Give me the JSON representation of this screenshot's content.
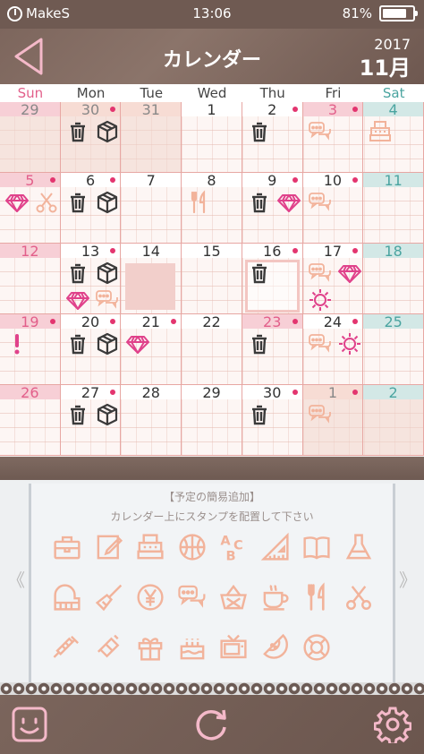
{
  "status_bar": {
    "carrier": "MakeS",
    "time": "13:06",
    "battery": "81%",
    "battery_level": 0.81
  },
  "header": {
    "title": "カレンダー",
    "year": "2017",
    "month": "11月"
  },
  "weekdays": [
    "Sun",
    "Mon",
    "Tue",
    "Wed",
    "Thu",
    "Fri",
    "Sat"
  ],
  "weeks": [
    {
      "days": [
        {
          "n": "29",
          "bar": "pink",
          "num": "gray",
          "out": true,
          "dot": false,
          "stamps": []
        },
        {
          "n": "30",
          "bar": "peach",
          "num": "gray",
          "out": true,
          "dot": true,
          "stamps": [
            "trash-icon",
            "box-icon"
          ]
        },
        {
          "n": "31",
          "bar": "peach",
          "num": "gray",
          "out": true,
          "dot": false,
          "stamps": []
        },
        {
          "n": "1",
          "bar": "white",
          "num": "",
          "out": false,
          "dot": false,
          "stamps": []
        },
        {
          "n": "2",
          "bar": "white",
          "num": "",
          "out": false,
          "dot": true,
          "stamps": [
            "trash-icon"
          ]
        },
        {
          "n": "3",
          "bar": "pink",
          "num": "red",
          "out": false,
          "dot": true,
          "stamps": [
            "chat-icon"
          ]
        },
        {
          "n": "4",
          "bar": "teal",
          "num": "teal",
          "out": false,
          "dot": false,
          "stamps": [
            "register-icon"
          ]
        }
      ]
    },
    {
      "days": [
        {
          "n": "5",
          "bar": "pink",
          "num": "red",
          "out": false,
          "dot": true,
          "stamps": [
            "gem-icon",
            "scissors-icon"
          ]
        },
        {
          "n": "6",
          "bar": "white",
          "num": "",
          "out": false,
          "dot": true,
          "stamps": [
            "trash-icon",
            "box-icon"
          ]
        },
        {
          "n": "7",
          "bar": "white",
          "num": "",
          "out": false,
          "dot": false,
          "stamps": []
        },
        {
          "n": "8",
          "bar": "white",
          "num": "",
          "out": false,
          "dot": false,
          "stamps": [
            "fork-knife-icon"
          ]
        },
        {
          "n": "9",
          "bar": "white",
          "num": "",
          "out": false,
          "dot": true,
          "stamps": [
            "trash-icon",
            "gem-icon"
          ]
        },
        {
          "n": "10",
          "bar": "white",
          "num": "",
          "out": false,
          "dot": true,
          "stamps": [
            "chat-icon"
          ]
        },
        {
          "n": "11",
          "bar": "teal",
          "num": "teal",
          "out": false,
          "dot": false,
          "stamps": []
        }
      ]
    },
    {
      "days": [
        {
          "n": "12",
          "bar": "pink",
          "num": "red",
          "out": false,
          "dot": false,
          "stamps": []
        },
        {
          "n": "13",
          "bar": "white",
          "num": "",
          "out": false,
          "dot": true,
          "stamps": [
            "trash-icon",
            "box-icon",
            "gem-icon",
            "chat-icon"
          ]
        },
        {
          "n": "14",
          "bar": "white",
          "num": "",
          "out": false,
          "dot": false,
          "stamps": [],
          "fill": true
        },
        {
          "n": "15",
          "bar": "white",
          "num": "",
          "out": false,
          "dot": false,
          "stamps": []
        },
        {
          "n": "16",
          "bar": "white",
          "num": "",
          "out": false,
          "dot": true,
          "stamps": [
            "trash-icon"
          ],
          "selected": true
        },
        {
          "n": "17",
          "bar": "white",
          "num": "",
          "out": false,
          "dot": true,
          "stamps": [
            "chat-icon",
            "gem-icon",
            "sun-icon"
          ]
        },
        {
          "n": "18",
          "bar": "teal",
          "num": "teal",
          "out": false,
          "dot": false,
          "stamps": []
        }
      ]
    },
    {
      "days": [
        {
          "n": "19",
          "bar": "pink",
          "num": "red",
          "out": false,
          "dot": true,
          "stamps": [
            "exclaim-icon"
          ]
        },
        {
          "n": "20",
          "bar": "white",
          "num": "",
          "out": false,
          "dot": true,
          "stamps": [
            "trash-icon",
            "box-icon"
          ]
        },
        {
          "n": "21",
          "bar": "white",
          "num": "",
          "out": false,
          "dot": true,
          "stamps": [
            "gem-icon"
          ]
        },
        {
          "n": "22",
          "bar": "white",
          "num": "",
          "out": false,
          "dot": false,
          "stamps": []
        },
        {
          "n": "23",
          "bar": "pink",
          "num": "red",
          "out": false,
          "dot": true,
          "stamps": [
            "trash-icon"
          ]
        },
        {
          "n": "24",
          "bar": "white",
          "num": "",
          "out": false,
          "dot": true,
          "stamps": [
            "chat-icon",
            "sun-icon"
          ]
        },
        {
          "n": "25",
          "bar": "teal",
          "num": "teal",
          "out": false,
          "dot": false,
          "stamps": []
        }
      ]
    },
    {
      "days": [
        {
          "n": "26",
          "bar": "pink",
          "num": "red",
          "out": false,
          "dot": false,
          "stamps": []
        },
        {
          "n": "27",
          "bar": "white",
          "num": "",
          "out": false,
          "dot": true,
          "stamps": [
            "trash-icon",
            "box-icon"
          ]
        },
        {
          "n": "28",
          "bar": "white",
          "num": "",
          "out": false,
          "dot": false,
          "stamps": []
        },
        {
          "n": "29",
          "bar": "white",
          "num": "",
          "out": false,
          "dot": false,
          "stamps": []
        },
        {
          "n": "30",
          "bar": "white",
          "num": "",
          "out": false,
          "dot": true,
          "stamps": [
            "trash-icon"
          ]
        },
        {
          "n": "1",
          "bar": "peach",
          "num": "gray",
          "out": true,
          "dot": true,
          "stamps": [
            "chat-icon"
          ]
        },
        {
          "n": "2",
          "bar": "teal",
          "num": "teal",
          "out": true,
          "dot": false,
          "stamps": []
        }
      ]
    }
  ],
  "panel": {
    "title": "【予定の簡易追加】",
    "subtitle": "カレンダー上にスタンプを配置して下さい",
    "stamps": [
      [
        "briefcase-icon",
        "pencil-note-icon",
        "register-icon",
        "basketball-icon",
        "abc-icon",
        "ruler-icon",
        "book-icon",
        "flask-icon"
      ],
      [
        "piano-icon",
        "broom-icon",
        "yen-icon",
        "chat-icon",
        "basket-icon",
        "cup-icon",
        "fork-knife-icon",
        "scissors-icon"
      ],
      [
        "syringe-icon",
        "ticket-icon",
        "gift-icon",
        "cake-icon",
        "tv-icon",
        "watermelon-icon",
        "lifebuoy-icon"
      ]
    ],
    "left_arrow": "《",
    "right_arrow": "》"
  },
  "colors": {
    "accent": "#e3356f",
    "stamp_dark": "#3a3a3a",
    "stamp_pink": "#e0428b",
    "stamp_peach": "#f2b39b",
    "header": "#7d665d"
  }
}
